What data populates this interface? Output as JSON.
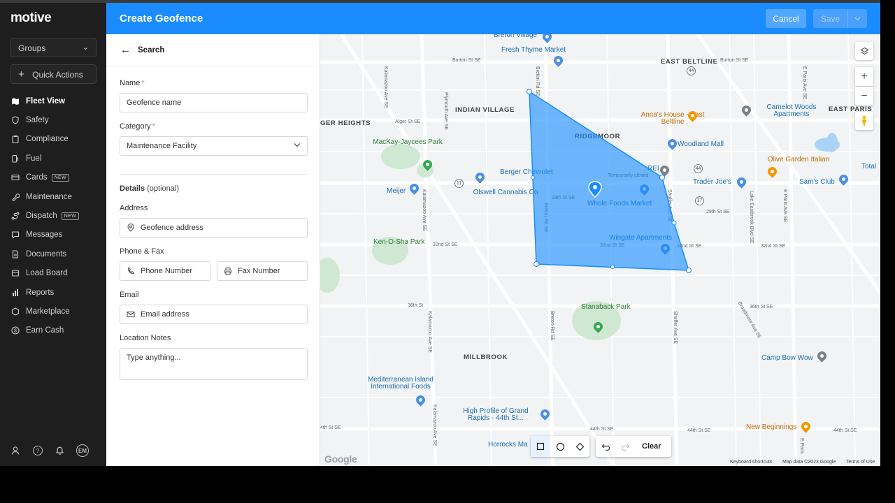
{
  "sidebar": {
    "logo": "motive",
    "groups_label": "Groups",
    "quick_actions_label": "Quick Actions",
    "items": [
      {
        "label": "Fleet View",
        "icon": "map-icon",
        "active": true
      },
      {
        "label": "Safety",
        "icon": "shield-icon"
      },
      {
        "label": "Compliance",
        "icon": "clipboard-icon"
      },
      {
        "label": "Fuel",
        "icon": "fuel-icon"
      },
      {
        "label": "Cards",
        "icon": "card-icon",
        "badge": "NEW"
      },
      {
        "label": "Maintenance",
        "icon": "wrench-icon"
      },
      {
        "label": "Dispatch",
        "icon": "dispatch-icon",
        "badge": "NEW"
      },
      {
        "label": "Messages",
        "icon": "message-icon"
      },
      {
        "label": "Documents",
        "icon": "document-icon"
      },
      {
        "label": "Load Board",
        "icon": "load-board-icon"
      },
      {
        "label": "Reports",
        "icon": "reports-icon"
      },
      {
        "label": "Marketplace",
        "icon": "marketplace-icon"
      },
      {
        "label": "Earn Cash",
        "icon": "dollar-icon"
      }
    ],
    "avatar_initials": "EM"
  },
  "header": {
    "title": "Create Geofence",
    "cancel_label": "Cancel",
    "save_label": "Save"
  },
  "form": {
    "back_label": "Search",
    "name_label": "Name",
    "required_mark": "*",
    "name_placeholder": "Geofence name",
    "category_label": "Category",
    "category_value": "Maintenance Facility",
    "details_label": "Details",
    "details_optional": "(optional)",
    "address_label": "Address",
    "address_placeholder": "Geofence address",
    "phone_fax_label": "Phone & Fax",
    "phone_placeholder": "Phone Number",
    "fax_placeholder": "Fax Number",
    "email_label": "Email",
    "email_placeholder": "Email address",
    "notes_label": "Location Notes",
    "notes_placeholder": "Type anything..."
  },
  "map": {
    "areas": [
      "EAST BELTLINE",
      "INDIAN VILLAGE",
      "GER HEIGHTS",
      "RIDGEMOOR",
      "EAST PARIS",
      "MILLBROOK"
    ],
    "pois": {
      "breton_village": "Breton Village",
      "fresh_thyme": "Fresh Thyme Market",
      "annas_house": "Anna's House - East Beltline",
      "camelot_woods": "Camelot Woods Apartments",
      "woodland_mall": "Woodland Mall",
      "mackay_jaycees": "MacKay-Jaycees Park",
      "berger_chevrolet": "Berger Chevrolet",
      "rei": "REI",
      "temporarily_closed": "Temporarily closed",
      "olive_garden": "Olive Garden Italian",
      "total": "Total",
      "meijer": "Meijer",
      "olswell": "Olswell Cannabis Co",
      "whole_foods": "Whole Foods Market",
      "trader_joes": "Trader Joe's",
      "sams_club": "Sam's Club",
      "ken_o_sha": "Ken-O-Sha Park",
      "wingate": "Wingate Apartments",
      "stanaback": "Stanaback Park",
      "camp_bow_wow": "Camp Bow Wow",
      "mediterranean": "Mediterranean Island International Foods",
      "high_profile": "High Profile of Grand Rapids - 44th St...",
      "new_beginnings": "New Beginnings",
      "horrocks": "Horrocks Ma"
    },
    "streets": {
      "burton_w": "Burton St SE",
      "burton_e": "Burton St SE",
      "alger": "Alger St SE",
      "st_29th": "29th St SE",
      "st_29th_e": "29th St SE",
      "st_32nd": "32nd St SE",
      "st_32nd_in": "32nd St SE",
      "st_32nd_e": "32nd St SE",
      "st_32nd_far": "32nd St SE",
      "st_36th": "36th St",
      "st_36th_e": "36th St SE",
      "st_44th_w": "4th St SE",
      "st_44th_m": "44th St SE",
      "st_44th_e": "44th St SE",
      "st_44th_far": "44th St SE",
      "kalamazoo": "Kalamazoo Ave SE",
      "kalamazoo2": "Kalamazoo Ave SE",
      "kalamazoo3": "Kalamazoo Ave SE",
      "kalamazoo4": "Kalamazoo Ave SE",
      "plymouth": "Plymouth Ave SE",
      "breton": "Breton Rd SE",
      "breton2": "Breton Rd SE",
      "breton3": "Breton Rd SE",
      "shaffer": "Shaffer Ave SE",
      "shaffer2": "Shaffer Ave SE",
      "lake_eastbrook": "Lake Eastbrook Blvd SE",
      "e_paris": "E Paris Ave SE",
      "e_paris2": "E Paris Ave SE",
      "e_paris3": "E Paris",
      "broadmoor": "Broadmoor Ave SE",
      "rt11": "11",
      "rt37": "37",
      "rt44a": "44",
      "rt44b": "44"
    },
    "google_logo": "Google",
    "keyboard_shortcuts": "Keyboard shortcuts",
    "map_data": "Map data ©2023 Google",
    "terms": "Terms of Use",
    "clear_label": "Clear",
    "geofence_color": "#1a8cff"
  }
}
